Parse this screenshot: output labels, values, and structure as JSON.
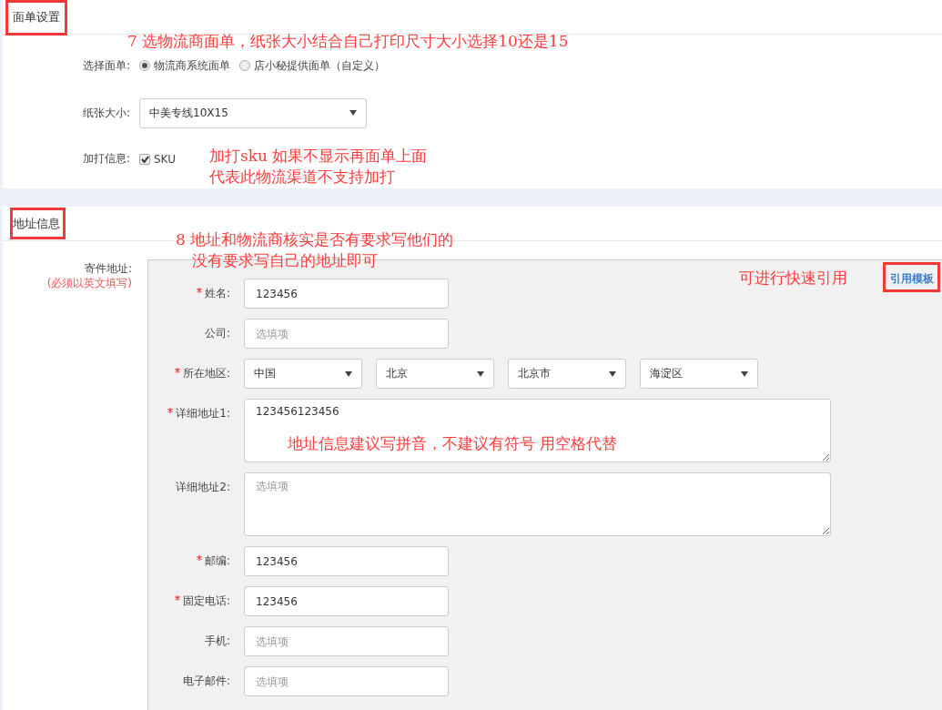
{
  "label_section": {
    "title": "面单设置",
    "template": {
      "label": "选择面单:",
      "options": [
        {
          "label": "物流商系统面单",
          "selected": true
        },
        {
          "label": "店小秘提供面单（自定义）",
          "selected": false
        }
      ]
    },
    "paper": {
      "label": "纸张大小:",
      "value": "中美专线10X15"
    },
    "extra": {
      "label": "加打信息:",
      "options": [
        {
          "label": "SKU",
          "checked": true
        }
      ]
    }
  },
  "address_section": {
    "title": "地址信息",
    "label": "寄件地址:",
    "note": "(必须以英文填写)",
    "link": "引用模板",
    "fields": [
      {
        "kind": "input",
        "label": "姓名:",
        "required": true,
        "value": "123456"
      },
      {
        "kind": "input",
        "label": "公司:",
        "required": false,
        "placeholder": "选填项"
      },
      {
        "kind": "region",
        "label": "所在地区:",
        "required": true,
        "values": [
          "中国",
          "北京",
          "北京市",
          "海淀区"
        ]
      },
      {
        "kind": "textarea",
        "label": "详细地址1:",
        "required": true,
        "value": "123456123456"
      },
      {
        "kind": "textarea",
        "label": "详细地址2:",
        "required": false,
        "placeholder": "选填项"
      },
      {
        "kind": "input",
        "label": "邮编:",
        "required": true,
        "value": "123456"
      },
      {
        "kind": "input",
        "label": "固定电话:",
        "required": true,
        "value": "123456"
      },
      {
        "kind": "input",
        "label": "手机:",
        "required": false,
        "placeholder": "选填项"
      },
      {
        "kind": "input",
        "label": "电子邮件:",
        "required": false,
        "placeholder": "选填项"
      }
    ]
  },
  "annotations": [
    {
      "lines": [
        "7 选物流商面单，纸张大小结合自己打印尺寸大小选择10还是15"
      ]
    },
    {
      "lines": [
        "加打sku 如果不显示再面单上面",
        "代表此物流渠道不支持加打"
      ]
    },
    {
      "lines": [
        "8 地址和物流商核实是否有要求写他们的",
        "没有要求写自己的地址即可"
      ]
    },
    {
      "lines": [
        "可进行快速引用"
      ]
    },
    {
      "lines": [
        "地址信息建议写拼音，不建议有符号 用空格代替"
      ]
    }
  ]
}
